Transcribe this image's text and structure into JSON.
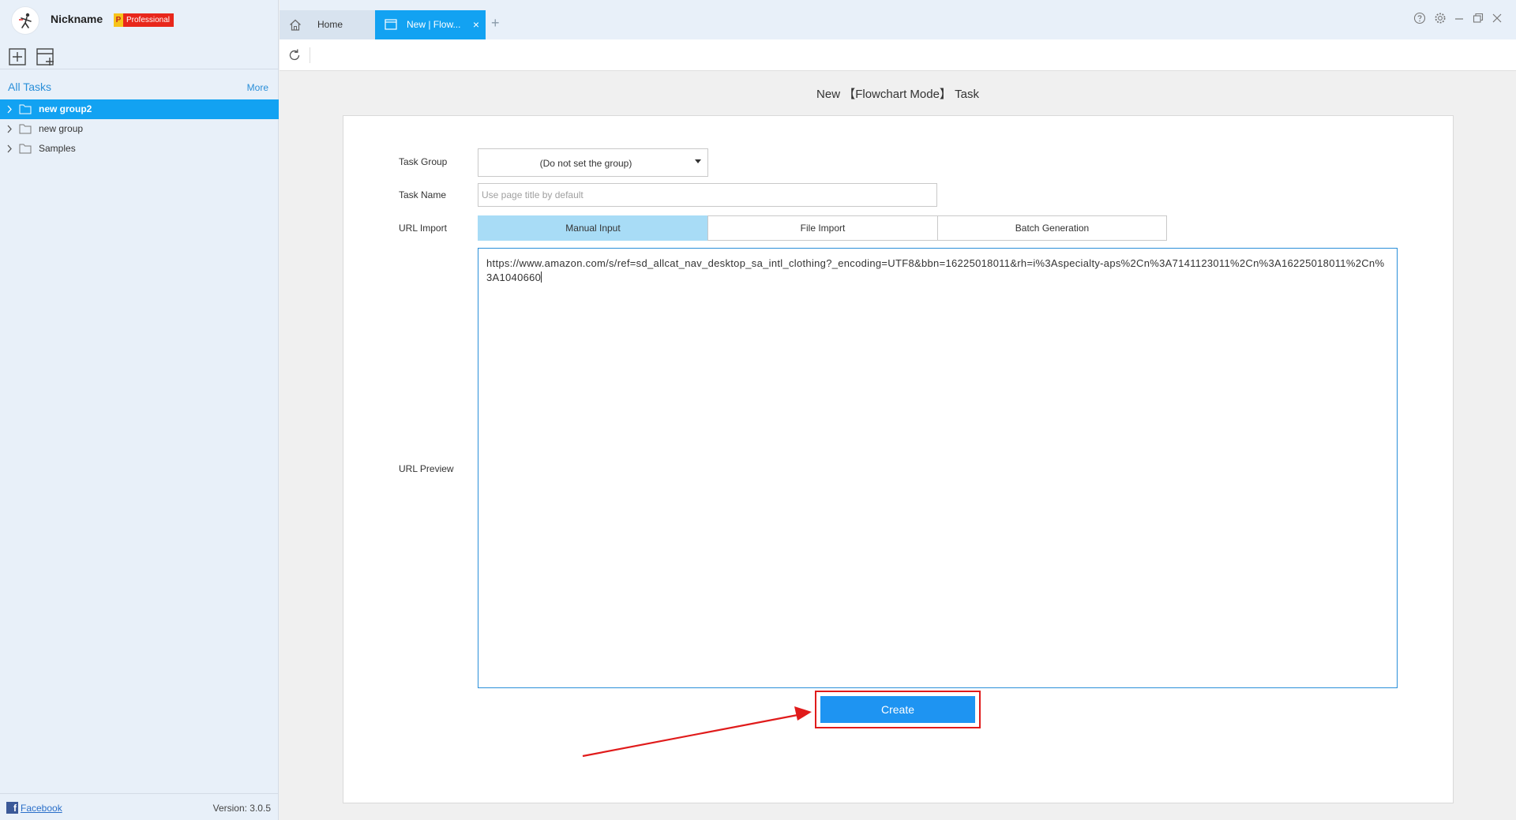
{
  "sidebar": {
    "nickname": "Nickname",
    "badge_letter": "P",
    "badge_label": "Professional",
    "all_tasks_label": "All Tasks",
    "more_label": "More",
    "groups": [
      {
        "label": "new group2",
        "selected": true
      },
      {
        "label": "new group",
        "selected": false
      },
      {
        "label": "Samples",
        "selected": false
      }
    ],
    "facebook_label": "Facebook",
    "version": "Version: 3.0.5"
  },
  "tabs": {
    "home_label": "Home",
    "active_label": "New | Flow...",
    "close_glyph": "×",
    "add_glyph": "+"
  },
  "main": {
    "page_title": "New 【Flowchart Mode】 Task",
    "task_group_label": "Task Group",
    "task_group_value": "(Do not set the group)",
    "task_name_label": "Task Name",
    "task_name_placeholder": "Use page title by default",
    "url_import_label": "URL Import",
    "url_import_options": [
      "Manual Input",
      "File Import",
      "Batch Generation"
    ],
    "url_import_selected": "Manual Input",
    "url_preview_label": "URL Preview",
    "url_text": "https://www.amazon.com/s/ref=sd_allcat_nav_desktop_sa_intl_clothing?_encoding=UTF8&bbn=16225018011&rh=i%3Aspecialty-aps%2Cn%3A7141123011%2Cn%3A16225018011%2Cn%3A1040660",
    "create_label": "Create"
  },
  "colors": {
    "accent": "#12a2f2",
    "annotation": "#e01b1b"
  }
}
